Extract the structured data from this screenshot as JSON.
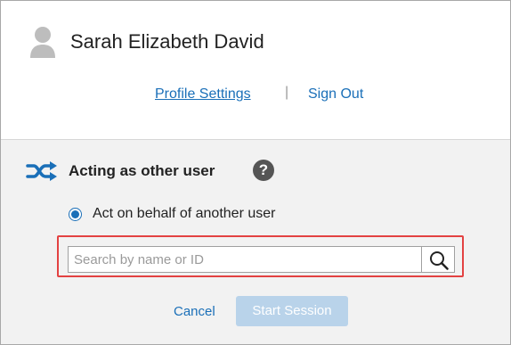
{
  "user": {
    "name": "Sarah Elizabeth David",
    "avatar_icon": "user-silhouette-icon"
  },
  "links": {
    "profile_settings": "Profile Settings",
    "divider": "|",
    "sign_out": "Sign Out"
  },
  "acting": {
    "icon": "shuffle-icon",
    "title": "Acting as other user",
    "help_icon": "help-icon",
    "help_glyph": "?",
    "option_label": "Act on behalf of another user",
    "option_selected": true
  },
  "search": {
    "placeholder": "Search by name or ID",
    "value": "",
    "button_icon": "search-icon"
  },
  "actions": {
    "cancel_label": "Cancel",
    "start_label": "Start Session",
    "start_enabled": false
  },
  "colors": {
    "link": "#1a6fb8",
    "highlight": "#e34242",
    "disabled_button": "#b9d3ea",
    "lower_background": "#f2f2f2"
  }
}
